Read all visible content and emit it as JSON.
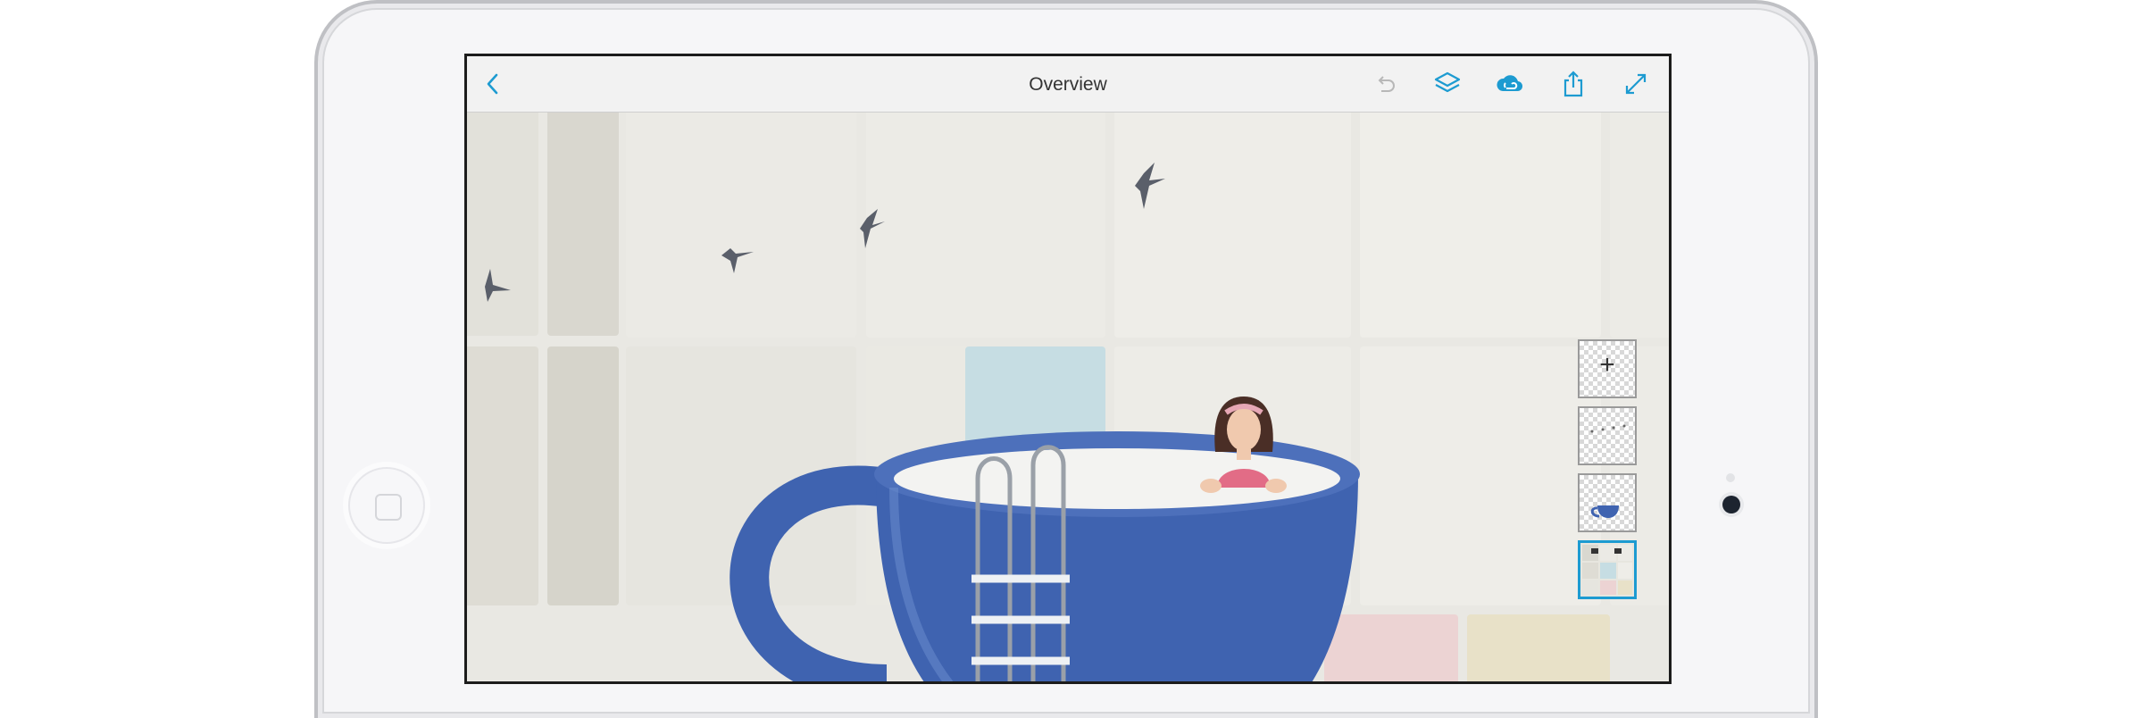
{
  "toolbar": {
    "title": "Overview",
    "back_icon": "chevron-left-icon",
    "undo_icon": "undo-icon",
    "layers_icon": "layers-icon",
    "cloud_icon": "creative-cloud-icon",
    "share_icon": "share-icon",
    "fullscreen_icon": "expand-icon"
  },
  "layers_panel": {
    "add_label": "+",
    "items": [
      {
        "name": "add-layer"
      },
      {
        "name": "birds-layer"
      },
      {
        "name": "cup-layer"
      },
      {
        "name": "background-layer",
        "selected": true
      }
    ]
  },
  "colors": {
    "accent": "#1d9bd1",
    "toolbar_bg": "#f2f2f2",
    "cup_blue": "#3f63b0",
    "tile_wall": "#ecebe6"
  }
}
